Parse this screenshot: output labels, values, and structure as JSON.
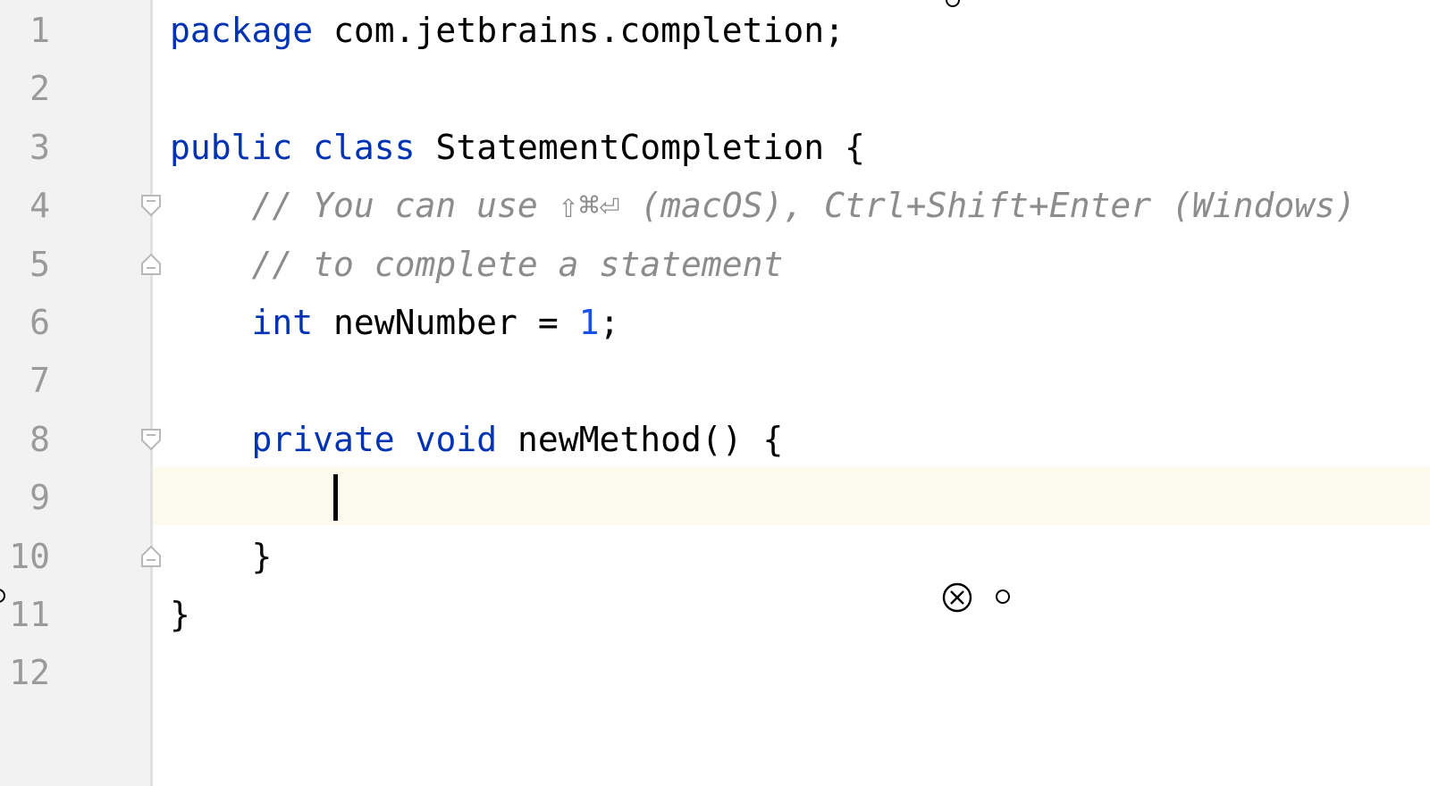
{
  "editor": {
    "language": "java",
    "caret": {
      "line": 9
    },
    "current_line": 9,
    "lines": [
      {
        "number": "1",
        "tokens": [
          {
            "t": "package",
            "c": "kw"
          },
          {
            "t": " ",
            "c": "punc"
          },
          {
            "t": "com.jetbrains.completion;",
            "c": "ident"
          }
        ]
      },
      {
        "number": "2",
        "tokens": []
      },
      {
        "number": "3",
        "tokens": [
          {
            "t": "public",
            "c": "kw"
          },
          {
            "t": " ",
            "c": "punc"
          },
          {
            "t": "class",
            "c": "kw"
          },
          {
            "t": " ",
            "c": "punc"
          },
          {
            "t": "StatementCompletion",
            "c": "cls"
          },
          {
            "t": " {",
            "c": "punc"
          }
        ]
      },
      {
        "number": "4",
        "fold": "open",
        "tokens": [
          {
            "t": "    ",
            "c": "punc"
          },
          {
            "t": "// You can use ⇧⌘⏎ (macOS), Ctrl+Shift+Enter (Windows)",
            "c": "cmt"
          }
        ]
      },
      {
        "number": "5",
        "fold": "close",
        "tokens": [
          {
            "t": "    ",
            "c": "punc"
          },
          {
            "t": "// to complete a statement",
            "c": "cmt"
          }
        ]
      },
      {
        "number": "6",
        "tokens": [
          {
            "t": "    ",
            "c": "punc"
          },
          {
            "t": "int",
            "c": "kw"
          },
          {
            "t": " newNumber = ",
            "c": "ident"
          },
          {
            "t": "1",
            "c": "num"
          },
          {
            "t": ";",
            "c": "punc"
          }
        ]
      },
      {
        "number": "7",
        "tokens": []
      },
      {
        "number": "8",
        "fold": "open",
        "tokens": [
          {
            "t": "    ",
            "c": "punc"
          },
          {
            "t": "private",
            "c": "kw"
          },
          {
            "t": " ",
            "c": "punc"
          },
          {
            "t": "void",
            "c": "kw"
          },
          {
            "t": " newMethod() {",
            "c": "ident"
          }
        ]
      },
      {
        "number": "9",
        "tokens": []
      },
      {
        "number": "10",
        "fold": "close",
        "tokens": [
          {
            "t": "    }",
            "c": "punc"
          }
        ]
      },
      {
        "number": "11",
        "tokens": [
          {
            "t": "}",
            "c": "punc"
          }
        ]
      },
      {
        "number": "12",
        "tokens": []
      }
    ]
  },
  "icons": {
    "cursor_target": "close-circle-icon",
    "cursor_dot": "circle-dot-icon"
  },
  "colors": {
    "keyword": "#0033b3",
    "number": "#1750eb",
    "comment": "#8c8c8c",
    "current_line": "#fcfaed",
    "gutter": "#f2f2f2",
    "line_number": "#9a9a9a"
  }
}
